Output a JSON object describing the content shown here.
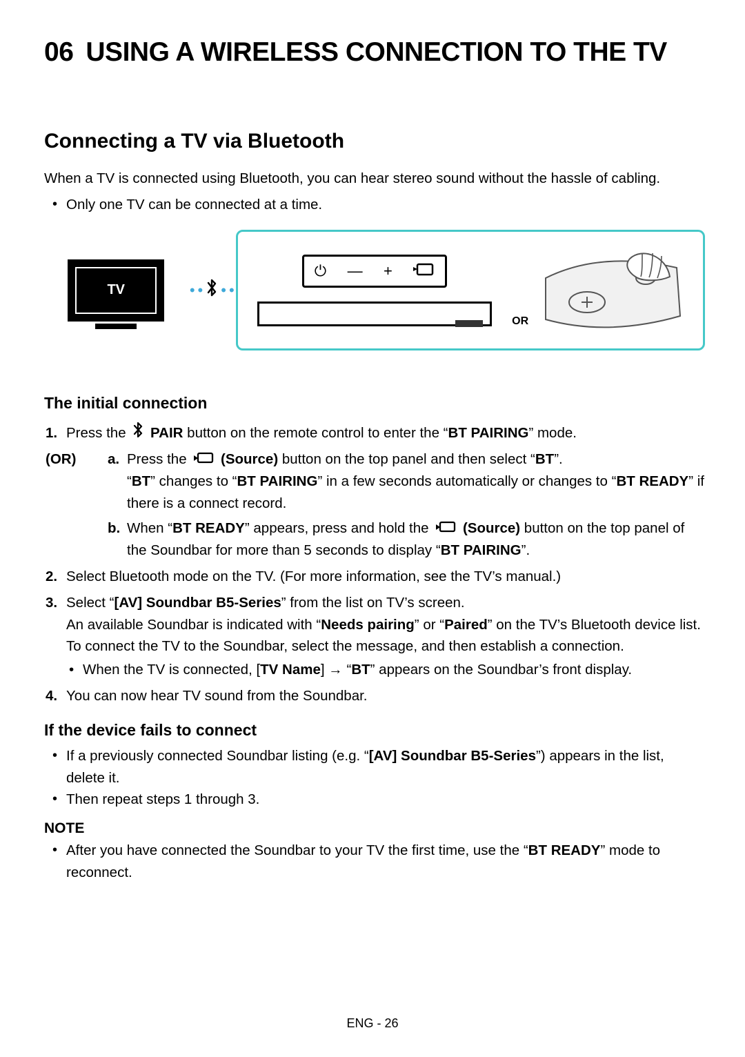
{
  "chapter": {
    "number": "06",
    "title": "USING A WIRELESS CONNECTION TO THE TV"
  },
  "section": {
    "title": "Connecting a TV via Bluetooth"
  },
  "intro": "When a TV is connected using Bluetooth, you can hear stereo sound without the hassle of cabling.",
  "intro_bullet": "Only one TV can be connected at a time.",
  "diagram": {
    "tv_label": "TV",
    "or_label": "OR"
  },
  "sub_initial": "The initial connection",
  "step1": {
    "num": "1.",
    "pre": "Press the ",
    "pair": "PAIR",
    "post": " button on the remote control to enter the “",
    "bt_pairing": "BT PAIRING",
    "end": "” mode."
  },
  "or_label": "(OR)",
  "step_a": {
    "letter": "a.",
    "l1_pre": "Press the ",
    "l1_src": "(Source)",
    "l1_mid": " button on the top panel and then select “",
    "l1_bt": "BT",
    "l1_end": "”.",
    "l2_a": "“",
    "l2_bt": "BT",
    "l2_b": "” changes to “",
    "l2_pair": "BT PAIRING",
    "l2_c": "” in a few seconds automatically or changes to “",
    "l2_ready": "BT READY",
    "l2_d": "” if there is a connect record."
  },
  "step_b": {
    "letter": "b.",
    "pre": "When “",
    "ready": "BT READY",
    "mid1": "” appears, press and hold the ",
    "src": "(Source)",
    "mid2": " button on the top panel of the Soundbar for more than 5 seconds to display “",
    "pair": "BT PAIRING",
    "end": "”."
  },
  "step2": {
    "num": "2.",
    "text": "Select Bluetooth mode on the TV. (For more information, see the TV’s manual.)"
  },
  "step3": {
    "num": "3.",
    "l1_a": "Select “",
    "l1_b": "[AV] Soundbar B5-Series",
    "l1_c": "” from the list on TV’s screen.",
    "l2_a": "An available Soundbar is indicated with “",
    "l2_b": "Needs pairing",
    "l2_c": "” or “",
    "l2_d": "Paired",
    "l2_e": "” on the TV’s Bluetooth device list. To connect the TV to the Soundbar, select the message, and then establish a connection.",
    "bullet_a": "When the TV is connected, [",
    "bullet_b": "TV Name",
    "bullet_c": "] → “",
    "bullet_d": "BT",
    "bullet_e": "” appears on the Soundbar’s front display."
  },
  "step4": {
    "num": "4.",
    "text": "You can now hear TV sound from the Soundbar."
  },
  "fail_title": "If the device fails to connect",
  "fail": {
    "b1_a": "If a previously connected Soundbar listing (e.g. “",
    "b1_b": "[AV] Soundbar B5-Series",
    "b1_c": "”) appears in the list, delete it.",
    "b2": "Then repeat steps 1 through 3."
  },
  "note_title": "NOTE",
  "note": {
    "a": "After you have connected the Soundbar to your TV the first time, use the “",
    "b": "BT READY",
    "c": "” mode to reconnect."
  },
  "footer": "ENG - 26"
}
